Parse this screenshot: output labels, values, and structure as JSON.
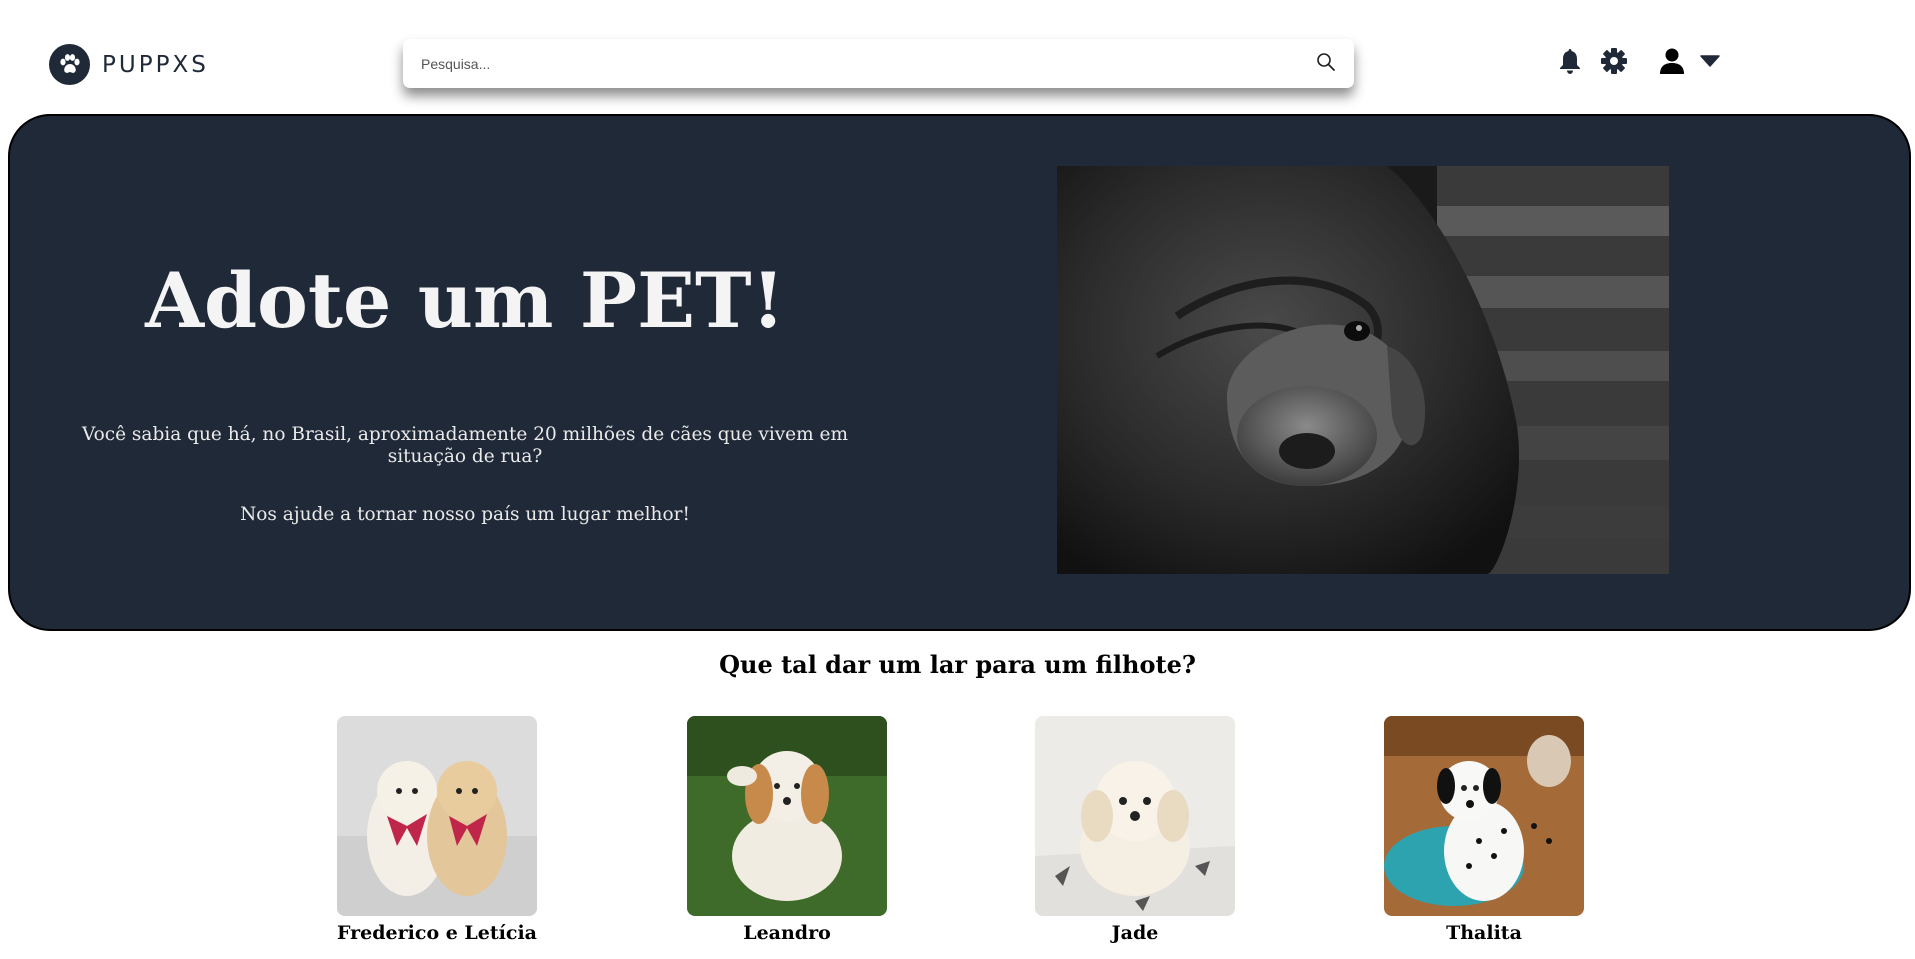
{
  "header": {
    "logo_text": "PUPPXS",
    "search_placeholder": "Pesquisa..."
  },
  "hero": {
    "title": "Adote um PET!",
    "text1": "Você sabia que há, no Brasil, aproximadamente 20 milhões de cães que vivem em situação de rua?",
    "text2": "Nos ajude a tornar nosso país um lugar melhor!"
  },
  "section": {
    "title": "Que tal dar um lar para um filhote?"
  },
  "pets": [
    {
      "name": "Frederico e Letícia"
    },
    {
      "name": "Leandro"
    },
    {
      "name": "Jade"
    },
    {
      "name": "Thalita"
    }
  ],
  "colors": {
    "brand_dark": "#202938",
    "hero_text": "#f4f4f4"
  },
  "icons": [
    "paw-icon",
    "search-icon",
    "bell-icon",
    "gear-icon",
    "user-icon",
    "caret-down-icon"
  ]
}
